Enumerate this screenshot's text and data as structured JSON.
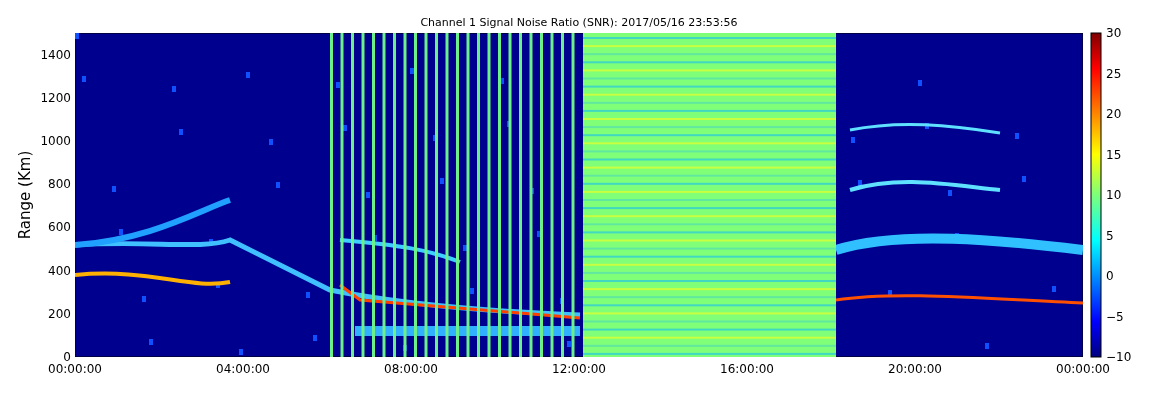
{
  "title": "Channel 1 Signal Noise Ratio (SNR): 2017/05/16 23:53:56",
  "ylabel": "Range (Km)",
  "yticks": [
    "1400",
    "1200",
    "1000",
    "800",
    "600",
    "400",
    "200",
    "0"
  ],
  "xticks": [
    "00:00:00",
    "04:00:00",
    "08:00:00",
    "12:00:00",
    "16:00:00",
    "20:00:00",
    "00:00:00"
  ],
  "colorbar": {
    "ticks": [
      "30",
      "25",
      "20",
      "15",
      "10",
      "5",
      "0",
      "−5",
      "−10"
    ]
  }
}
